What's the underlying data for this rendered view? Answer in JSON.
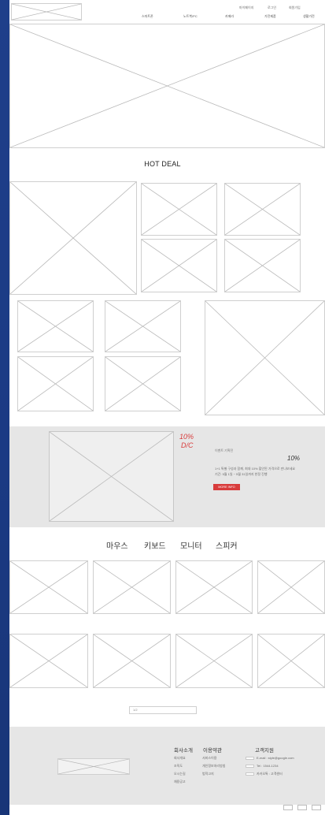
{
  "header": {
    "top_links": [
      "마이페이지",
      "로그인",
      "회원가입"
    ],
    "nav_items": [
      "스마트폰",
      "노트북/PC",
      "카메라",
      "가전제품",
      "생활가전"
    ]
  },
  "sections": {
    "hot_deal_title": "HOT DEAL"
  },
  "promo": {
    "discount_headline": "10%",
    "discount_subline": "D/C",
    "sub_title": "이벤트 기획전",
    "percent": "10%",
    "desc_line_1": "1+1 특별 구성과 함께, 최대 10% 할인된 가격으로 만나보세요",
    "desc_line_2": "기간: 5월 1일 ~ 5월 31일까지 한정 진행",
    "cta_label": "MORE INFO"
  },
  "categories": [
    "마우스",
    "키보드",
    "모니터",
    "스피커"
  ],
  "pagination": {
    "label": "1/2"
  },
  "footer": {
    "columns": {
      "about": {
        "title": "회사소개",
        "links": [
          "회사개요",
          "조직도",
          "오시는길",
          "채용공고"
        ]
      },
      "terms": {
        "title": "이용약관",
        "links": [
          "서비스이용",
          "개인정보처리방침",
          "법적고지"
        ]
      },
      "support": {
        "title": "고객지원",
        "email": "E-mail : style@google.com",
        "phone": "Tel : 1544-1234",
        "kakao": "카카오톡 : 고객센터"
      }
    }
  },
  "colors": {
    "accent": "#d83c3c",
    "page_bg": "#1f3f8a",
    "section_gray": "#e6e6e6"
  }
}
